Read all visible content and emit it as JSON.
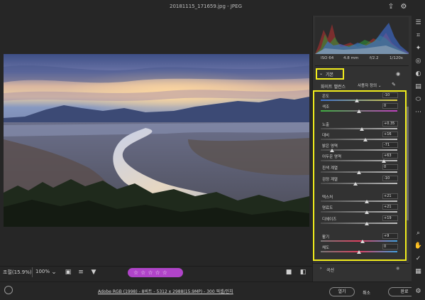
{
  "titlebar": {
    "title": "20181115_171659.jpg - JPEG"
  },
  "bottom_toolbar": {
    "zoom_fit": "조절(15.9%)",
    "zoom_pct": "100%",
    "stars": "☆☆☆☆☆"
  },
  "status": {
    "file_info": "Adobe RGB (1998) - 8비트 - 5312 x 2988(15.9MP) - 300 픽셀/인치",
    "open_label": "열기",
    "cancel_label": "취소",
    "done_label": "완료"
  },
  "exif": {
    "iso": "ISO 64",
    "focal": "4.8 mm",
    "aperture": "f/2.2",
    "shutter": "1/120s"
  },
  "panel": {
    "basic_label": "기본",
    "wb_label": "화이트 밸런스",
    "wb_value": "사용자 정의",
    "curve_label": "곡선"
  },
  "sliders": [
    {
      "label": "온도",
      "value": "-10",
      "level": 0.47,
      "track": "temp"
    },
    {
      "label": "색조",
      "value": "0",
      "level": 0.5,
      "track": "tint"
    },
    {
      "label": "노출",
      "value": "+0.35",
      "level": 0.54,
      "track": "gray"
    },
    {
      "label": "대비",
      "value": "+16",
      "level": 0.58,
      "track": "gray"
    },
    {
      "label": "밝은 영역",
      "value": "-71",
      "level": 0.15,
      "track": "gray"
    },
    {
      "label": "어두운 영역",
      "value": "+63",
      "level": 0.82,
      "track": "gray"
    },
    {
      "label": "흰색 계열",
      "value": "0",
      "level": 0.5,
      "track": "gray"
    },
    {
      "label": "검정 계열",
      "value": "-10",
      "level": 0.45,
      "track": "gray"
    },
    {
      "label": "텍스처",
      "value": "+21",
      "level": 0.6,
      "track": "gray"
    },
    {
      "label": "명료도",
      "value": "+21",
      "level": 0.6,
      "track": "gray"
    },
    {
      "label": "디헤이즈",
      "value": "+19",
      "level": 0.6,
      "track": "gray"
    },
    {
      "label": "활기",
      "value": "+9",
      "level": 0.55,
      "track": "vib"
    },
    {
      "label": "채도",
      "value": "0",
      "level": 0.5,
      "track": "sat"
    }
  ],
  "colors": {
    "highlight": "#f1ec1c",
    "rating": "#b044c9",
    "panel": "#323232",
    "background": "#262626"
  }
}
